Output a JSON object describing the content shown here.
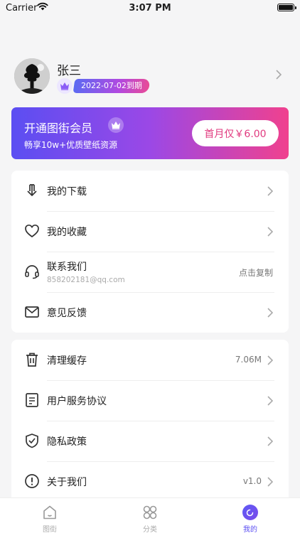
{
  "status_bar": {
    "carrier": "Carrier",
    "time": "3:07 PM"
  },
  "profile": {
    "name": "张三",
    "vip_expiry": "2022-07-02到期"
  },
  "vip_banner": {
    "title": "开通图街会员",
    "subtitle": "畅享10w+优质壁纸资源",
    "button": "首月仅￥6.00"
  },
  "menu_group1": [
    {
      "label": "我的下载",
      "icon": "download-icon"
    },
    {
      "label": "我的收藏",
      "icon": "heart-icon"
    },
    {
      "label": "联系我们",
      "sublabel": "858202181@qq.com",
      "value": "点击复制",
      "icon": "headset-icon"
    },
    {
      "label": "意见反馈",
      "icon": "mail-icon"
    }
  ],
  "menu_group2": [
    {
      "label": "清理缓存",
      "value": "7.06M",
      "icon": "trash-icon"
    },
    {
      "label": "用户服务协议",
      "icon": "document-icon"
    },
    {
      "label": "隐私政策",
      "icon": "shield-icon"
    },
    {
      "label": "关于我们",
      "value": "v1.0",
      "icon": "info-icon"
    }
  ],
  "tabs": [
    {
      "label": "图街",
      "icon": "home-icon"
    },
    {
      "label": "分类",
      "icon": "grid-icon"
    },
    {
      "label": "我的",
      "icon": "moon-icon"
    }
  ],
  "colors": {
    "accent": "#5b4ef2",
    "pink": "#e13a7f",
    "background": "#f5f5f6"
  }
}
